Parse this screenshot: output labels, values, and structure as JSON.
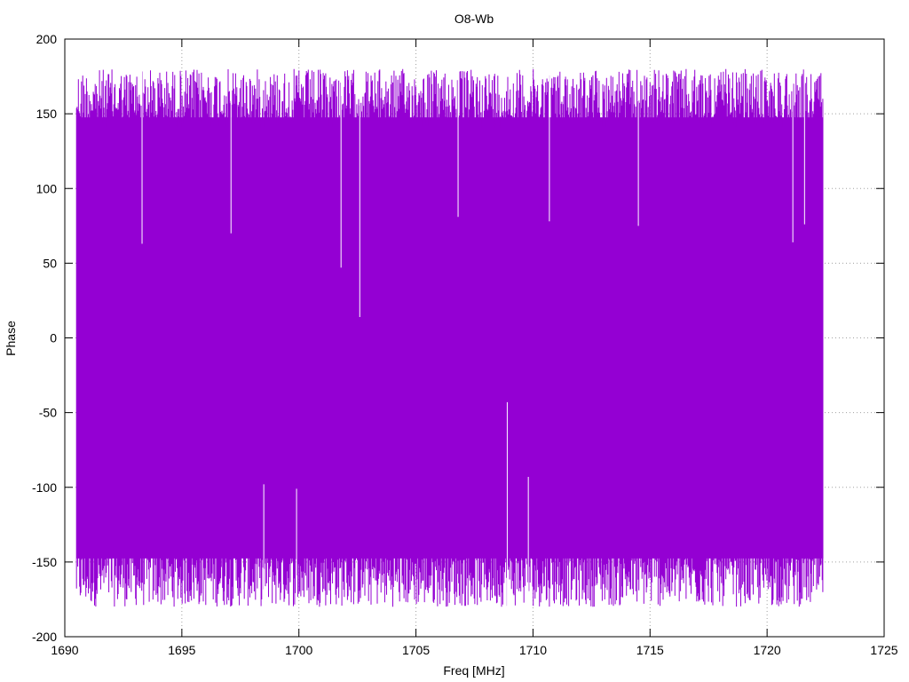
{
  "chart_data": {
    "type": "line",
    "title": "O8-Wb",
    "xlabel": "Freq [MHz]",
    "ylabel": "Phase",
    "xlim": [
      1690,
      1725
    ],
    "ylim": [
      -200,
      200
    ],
    "xticks": [
      1690,
      1695,
      1700,
      1705,
      1710,
      1715,
      1720,
      1725
    ],
    "yticks": [
      200,
      150,
      100,
      50,
      0,
      -50,
      -100,
      -150,
      -200
    ],
    "grid": true,
    "legend": "none",
    "series": [
      {
        "color": "#9400d3",
        "description_of_data": "dense wrapped phase samples spanning about -180 to 180 degrees across the band",
        "x_range": [
          1690.5,
          1722.4
        ],
        "y_envelope": [
          -180,
          180
        ],
        "spikes": [
          {
            "x": 1702.6,
            "y": 14
          },
          {
            "x": 1701.8,
            "y": 47
          },
          {
            "x": 1708.9,
            "y": -43
          },
          {
            "x": 1693.3,
            "y": 63
          },
          {
            "x": 1697.1,
            "y": 70
          },
          {
            "x": 1706.8,
            "y": 81
          },
          {
            "x": 1721.1,
            "y": 64
          },
          {
            "x": 1721.6,
            "y": 76
          },
          {
            "x": 1714.5,
            "y": 75
          },
          {
            "x": 1710.7,
            "y": 78
          },
          {
            "x": 1709.8,
            "y": -93
          },
          {
            "x": 1698.5,
            "y": -98
          },
          {
            "x": 1699.9,
            "y": -101
          }
        ]
      }
    ]
  }
}
